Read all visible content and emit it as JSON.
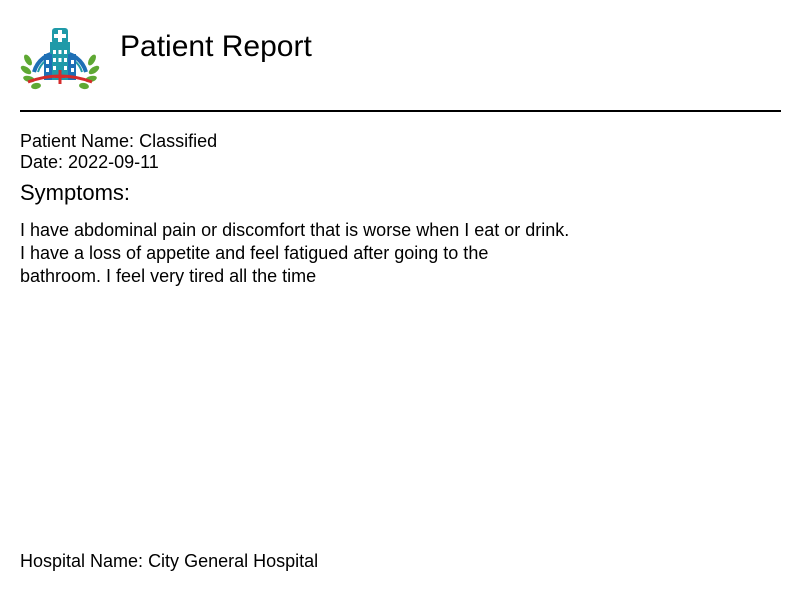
{
  "report": {
    "title": "Patient Report",
    "logo_icon": "hospital-logo-icon",
    "patient_name_label": "Patient Name:",
    "patient_name": "Classified",
    "date_label": "Date:",
    "date": "2022-09-11",
    "symptoms_heading": "Symptoms:",
    "symptoms_lines": [
      "I have abdominal pain or discomfort that is worse when I eat or drink.",
      "I have a loss of appetite and feel fatigued after going to the",
      "bathroom. I feel very tired all the time"
    ],
    "hospital_label": "Hospital Name:",
    "hospital_name": "City General Hospital"
  },
  "colors": {
    "logo_blue": "#1e6fb5",
    "logo_teal": "#1f9aa8",
    "logo_green": "#5ea833",
    "logo_red": "#d52b2b"
  }
}
